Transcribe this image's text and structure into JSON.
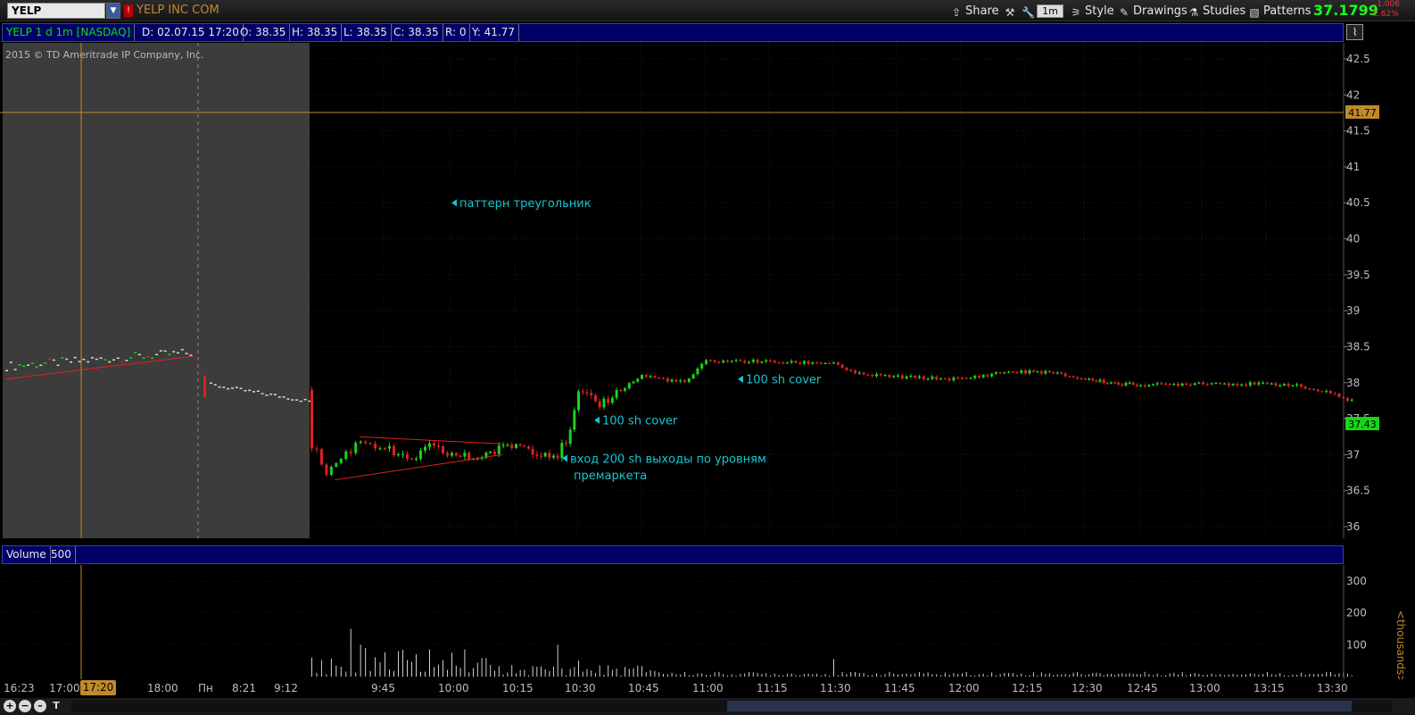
{
  "toolbar": {
    "symbol": "YELP",
    "company": "YELP INC COM",
    "buttons": {
      "share": "Share",
      "style": "Style",
      "drawings": "Drawings",
      "studies": "Studies",
      "patterns": "Patterns"
    },
    "timeframe_badge": "1m",
    "last_price": "37.1799",
    "change_abs": "-1.006",
    "change_pct": "-2.62%"
  },
  "info_bar": {
    "title": "YELP 1 d 1m [NASDAQ]",
    "date": "D: 02.07.15 17:20",
    "open": "O: 38.35",
    "high": "H: 38.35",
    "low": "L: 38.35",
    "close": "C: 38.35",
    "range": "R: 0",
    "cursor_y": "Y: 41.77"
  },
  "watermark": "2015 © TD Ameritrade IP Company, Inc.",
  "colors": {
    "up": "#19d419",
    "down": "#e02020",
    "neutral": "#d8d8d8",
    "annotation": "#16c6cf",
    "cursor": "#c08a2a",
    "infobar_bg": "#000066"
  },
  "price_axis": {
    "min": 36,
    "max": 42.5,
    "ticks": [
      "42.5",
      "42",
      "41.5",
      "41",
      "40.5",
      "40",
      "39.5",
      "39",
      "38.5",
      "38",
      "37.5",
      "37",
      "36.5",
      "36"
    ],
    "cursor_label": "41.77",
    "last_label": "37.43"
  },
  "annotations": [
    {
      "text": "паттерн треугольник",
      "price": 40.5,
      "time_index": 2
    },
    {
      "text": "вход 200 sh выходы по уровням",
      "price": 36.95,
      "time_index": 13
    },
    {
      "text": "премаркета",
      "price": 36.72,
      "time_index": 13
    },
    {
      "text": "100 sh cover",
      "price": 37.48,
      "time_index": 14
    },
    {
      "text": "100 sh cover",
      "price": 38.05,
      "time_index": 17
    }
  ],
  "volume_panel": {
    "label": "Volume",
    "value": "500",
    "ticks": [
      "300",
      "200",
      "100"
    ],
    "unit": "<thousands>"
  },
  "time_axis": {
    "labels": [
      "16:23",
      "17:00",
      "18:00",
      "Пн",
      "8:21",
      "9:12",
      "9:45",
      "10:00",
      "10:15",
      "10:30",
      "10:45",
      "11:00",
      "11:15",
      "11:30",
      "11:45",
      "12:00",
      "12:15",
      "12:30",
      "12:45",
      "13:00",
      "13:15",
      "13:30"
    ],
    "current_time": "17:20"
  },
  "chart_data": {
    "type": "candlestick",
    "symbol": "YELP",
    "ylim": [
      36,
      42.5
    ],
    "volume_ylim": [
      0,
      350
    ],
    "segments": [
      {
        "session": "after-hours",
        "start": "16:23",
        "end": "18:30",
        "approx_range": [
          38.15,
          38.5
        ]
      },
      {
        "session": "pre-market",
        "start": "8:21",
        "end": "9:30",
        "approx_range": [
          37.7,
          38.1
        ]
      },
      {
        "session": "regular",
        "start": "9:30",
        "end": "13:35"
      }
    ],
    "regular_session_closes": [
      {
        "t": "9:30",
        "c": 37.15
      },
      {
        "t": "9:33",
        "c": 36.75
      },
      {
        "t": "9:36",
        "c": 36.95
      },
      {
        "t": "9:40",
        "c": 37.2
      },
      {
        "t": "9:45",
        "c": 37.1
      },
      {
        "t": "9:50",
        "c": 36.9
      },
      {
        "t": "9:55",
        "c": 37.1
      },
      {
        "t": "10:00",
        "c": 37.0
      },
      {
        "t": "10:05",
        "c": 36.95
      },
      {
        "t": "10:10",
        "c": 37.05
      },
      {
        "t": "10:15",
        "c": 37.15
      },
      {
        "t": "10:20",
        "c": 37.05
      },
      {
        "t": "10:25",
        "c": 37.0
      },
      {
        "t": "10:28",
        "c": 37.3
      },
      {
        "t": "10:30",
        "c": 37.85
      },
      {
        "t": "10:35",
        "c": 37.7
      },
      {
        "t": "10:40",
        "c": 37.9
      },
      {
        "t": "10:45",
        "c": 38.1
      },
      {
        "t": "10:50",
        "c": 38.05
      },
      {
        "t": "10:55",
        "c": 38.0
      },
      {
        "t": "11:00",
        "c": 38.3
      },
      {
        "t": "11:10",
        "c": 38.3
      },
      {
        "t": "11:20",
        "c": 38.28
      },
      {
        "t": "11:30",
        "c": 38.28
      },
      {
        "t": "11:35",
        "c": 38.12
      },
      {
        "t": "11:45",
        "c": 38.08
      },
      {
        "t": "12:00",
        "c": 38.05
      },
      {
        "t": "12:10",
        "c": 38.15
      },
      {
        "t": "12:20",
        "c": 38.15
      },
      {
        "t": "12:30",
        "c": 38.05
      },
      {
        "t": "12:40",
        "c": 37.98
      },
      {
        "t": "12:50",
        "c": 37.97
      },
      {
        "t": "13:00",
        "c": 38.0
      },
      {
        "t": "13:10",
        "c": 37.98
      },
      {
        "t": "13:20",
        "c": 37.98
      },
      {
        "t": "13:30",
        "c": 37.85
      },
      {
        "t": "13:35",
        "c": 37.75
      }
    ],
    "volume_spikes_thousands": [
      {
        "t": "9:30",
        "v": 60
      },
      {
        "t": "9:38",
        "v": 150
      },
      {
        "t": "9:40",
        "v": 100
      },
      {
        "t": "10:00",
        "v": 75
      },
      {
        "t": "10:25",
        "v": 100
      },
      {
        "t": "10:30",
        "v": 50
      },
      {
        "t": "11:30",
        "v": 55
      }
    ],
    "drawings": [
      {
        "type": "trendline",
        "label": "triangle upper",
        "from": {
          "t": "9:40",
          "p": 37.25
        },
        "to": {
          "t": "10:12",
          "p": 37.15
        }
      },
      {
        "type": "trendline",
        "label": "triangle lower",
        "from": {
          "t": "9:35",
          "p": 36.65
        },
        "to": {
          "t": "10:12",
          "p": 37.0
        }
      },
      {
        "type": "trendline",
        "label": "after-hours support",
        "from": {
          "t": "16:23",
          "p": 38.05
        },
        "to": {
          "t": "18:30",
          "p": 38.37
        }
      }
    ]
  }
}
